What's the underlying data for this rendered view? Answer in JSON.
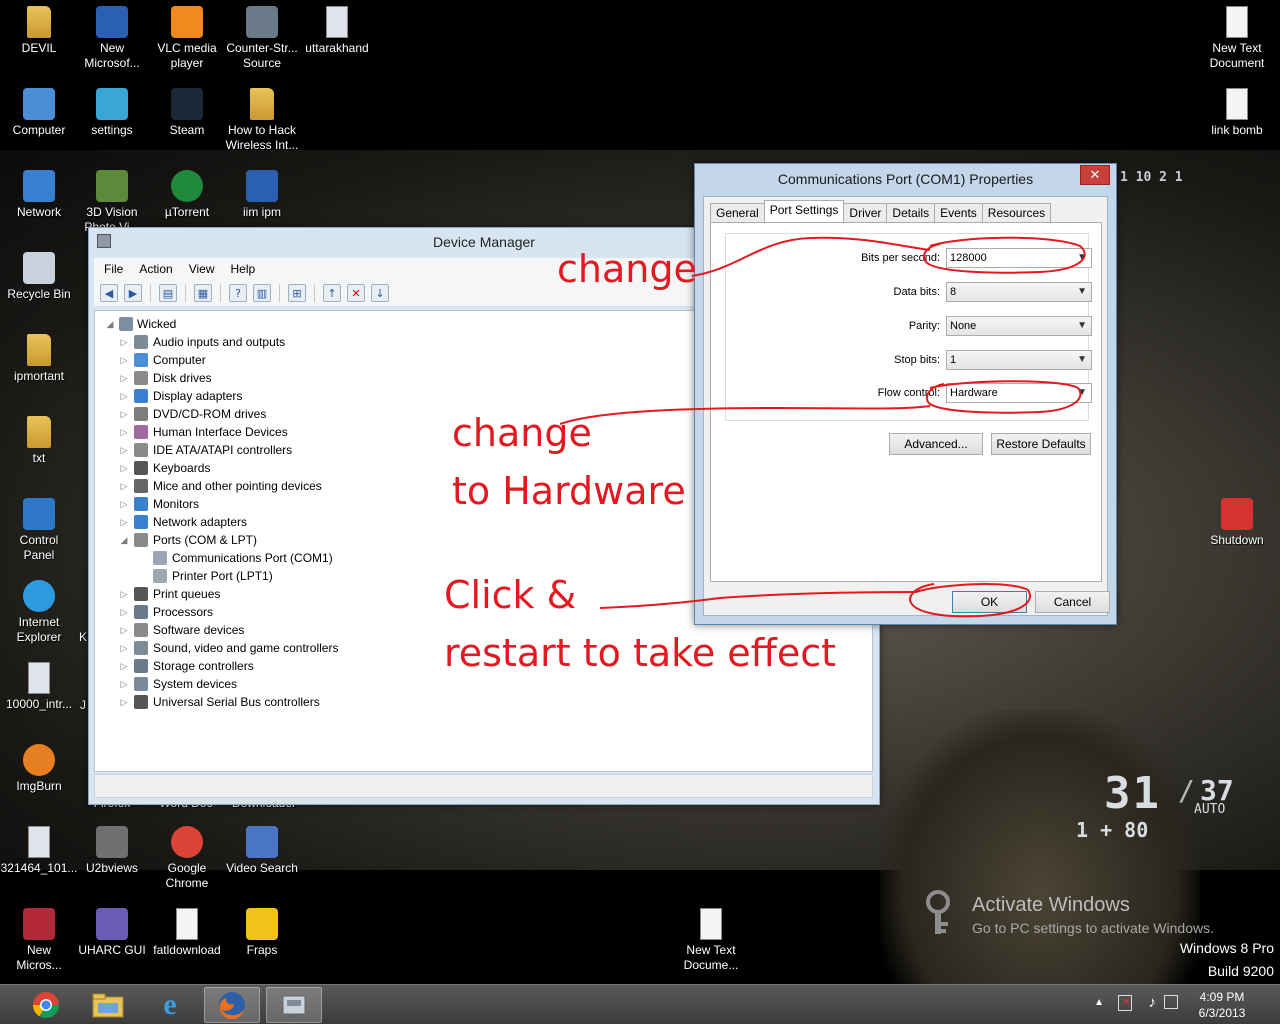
{
  "desktop": {
    "icons": [
      {
        "label": "DEVIL",
        "icon": "folder-icon",
        "name": "desktop-icon-devil"
      },
      {
        "label": "New\nMicrosof...",
        "icon": "word-document-icon",
        "name": "desktop-icon-new-microsoft"
      },
      {
        "label": "VLC media\nplayer",
        "icon": "vlc-icon",
        "name": "desktop-icon-vlc"
      },
      {
        "label": "Counter-Str...\nSource",
        "icon": "counter-strike-icon",
        "name": "desktop-icon-counter-strike"
      },
      {
        "label": "uttarakhand",
        "icon": "document-icon",
        "name": "desktop-icon-uttarakhand"
      },
      {
        "label": "New Text\nDocument",
        "icon": "text-file-icon",
        "name": "desktop-icon-new-text-document-top"
      },
      {
        "label": "Computer",
        "icon": "computer-icon",
        "name": "desktop-icon-computer"
      },
      {
        "label": "settings",
        "icon": "settings-icon",
        "name": "desktop-icon-settings"
      },
      {
        "label": "Steam",
        "icon": "steam-icon",
        "name": "desktop-icon-steam"
      },
      {
        "label": "How to Hack\nWireless Int...",
        "icon": "folder-icon",
        "name": "desktop-icon-how-to-hack"
      },
      {
        "label": "link bomb",
        "icon": "text-file-icon",
        "name": "desktop-icon-link-bomb"
      },
      {
        "label": "Network",
        "icon": "network-icon",
        "name": "desktop-icon-network"
      },
      {
        "label": "3D Vision\nPhoto Vi...",
        "icon": "3d-vision-icon",
        "name": "desktop-icon-3d-vision"
      },
      {
        "label": "µTorrent",
        "icon": "utorrent-icon",
        "name": "desktop-icon-utorrent"
      },
      {
        "label": "iim  ipm",
        "icon": "word-document-icon",
        "name": "desktop-icon-iim-ipm"
      },
      {
        "label": "Recycle Bin",
        "icon": "recycle-bin-icon",
        "name": "desktop-icon-recycle-bin"
      },
      {
        "label": "ipmortant",
        "icon": "folder-icon",
        "name": "desktop-icon-ipmortant"
      },
      {
        "label": "txt",
        "icon": "folder-icon",
        "name": "desktop-icon-txt"
      },
      {
        "label": "Control\nPanel",
        "icon": "control-panel-icon",
        "name": "desktop-icon-control-panel"
      },
      {
        "label": "Shutdown",
        "icon": "shutdown-icon",
        "name": "desktop-icon-shutdown"
      },
      {
        "label": "Internet\nExplorer",
        "icon": "internet-explorer-icon",
        "name": "desktop-icon-internet-explorer"
      },
      {
        "label": "10000_intr...",
        "icon": "document-icon",
        "name": "desktop-icon-10000-intr"
      },
      {
        "label": "ImgBurn",
        "icon": "imgburn-icon",
        "name": "desktop-icon-imgburn"
      },
      {
        "label": "321464_101...",
        "icon": "document-icon",
        "name": "desktop-icon-321464"
      },
      {
        "label": "U2bviews",
        "icon": "u2bviews-icon",
        "name": "desktop-icon-u2bviews"
      },
      {
        "label": "Google\nChrome",
        "icon": "chrome-icon",
        "name": "desktop-icon-google-chrome"
      },
      {
        "label": "Video Search",
        "icon": "video-search-icon",
        "name": "desktop-icon-video-search"
      },
      {
        "label": "New\nMicros...",
        "icon": "access-icon",
        "name": "desktop-icon-new-micros"
      },
      {
        "label": "UHARC GUI",
        "icon": "uharc-icon",
        "name": "desktop-icon-uharc-gui"
      },
      {
        "label": "fatldownload",
        "icon": "text-file-icon",
        "name": "desktop-icon-fatldownload"
      },
      {
        "label": "Fraps",
        "icon": "fraps-icon",
        "name": "desktop-icon-fraps"
      },
      {
        "label": "New Text\nDocume...",
        "icon": "text-file-icon",
        "name": "desktop-icon-new-text-document-bottom"
      }
    ],
    "hidden_labels": {
      "k1": "K",
      "k2": "J",
      "firefox": "Firefox",
      "word_doc": "Word Doc",
      "downloader": "Downloader"
    }
  },
  "hud": {
    "main": "31",
    "slash": "/",
    "reserve": "37",
    "mode": "AUTO",
    "row2": "1 + 80",
    "top": "1 10  2  1"
  },
  "device_manager": {
    "title": "Device Manager",
    "menu": [
      "File",
      "Action",
      "View",
      "Help"
    ],
    "root": "Wicked",
    "items": [
      "Audio inputs and outputs",
      "Computer",
      "Disk drives",
      "Display adapters",
      "DVD/CD-ROM drives",
      "Human Interface Devices",
      "IDE ATA/ATAPI controllers",
      "Keyboards",
      "Mice and other pointing devices",
      "Monitors",
      "Network adapters",
      "Ports (COM & LPT)",
      "Print queues",
      "Processors",
      "Software devices",
      "Sound, video and game controllers",
      "Storage controllers",
      "System devices",
      "Universal Serial Bus controllers"
    ],
    "ports_children": [
      "Communications Port (COM1)",
      "Printer Port (LPT1)"
    ]
  },
  "properties": {
    "title": "Communications Port (COM1) Properties",
    "close": "✕",
    "tabs": [
      "General",
      "Port Settings",
      "Driver",
      "Details",
      "Events",
      "Resources"
    ],
    "active_tab": "Port Settings",
    "fields": {
      "bits_per_second": {
        "label": "Bits per second:",
        "value": "128000"
      },
      "data_bits": {
        "label": "Data bits:",
        "value": "8"
      },
      "parity": {
        "label": "Parity:",
        "value": "None"
      },
      "stop_bits": {
        "label": "Stop bits:",
        "value": "1"
      },
      "flow_control": {
        "label": "Flow control:",
        "value": "Hardware"
      }
    },
    "advanced": "Advanced...",
    "restore_defaults": "Restore Defaults",
    "ok": "OK",
    "cancel": "Cancel"
  },
  "annotations": {
    "change1": "change",
    "change2": "change",
    "to_hardware": "to Hardware",
    "click": "Click &",
    "restart": "restart to take effect",
    "color": "#e3191f"
  },
  "watermark": {
    "title": "Activate Windows",
    "subtitle": "Go to PC settings to activate Windows.",
    "edition": "Windows 8 Pro",
    "build": "Build 9200"
  },
  "taskbar": {
    "apps": [
      "chrome-icon",
      "file-explorer-icon",
      "internet-explorer-icon",
      "firefox-icon",
      "device-manager-icon"
    ],
    "time": "4:09 PM",
    "date": "6/3/2013"
  }
}
